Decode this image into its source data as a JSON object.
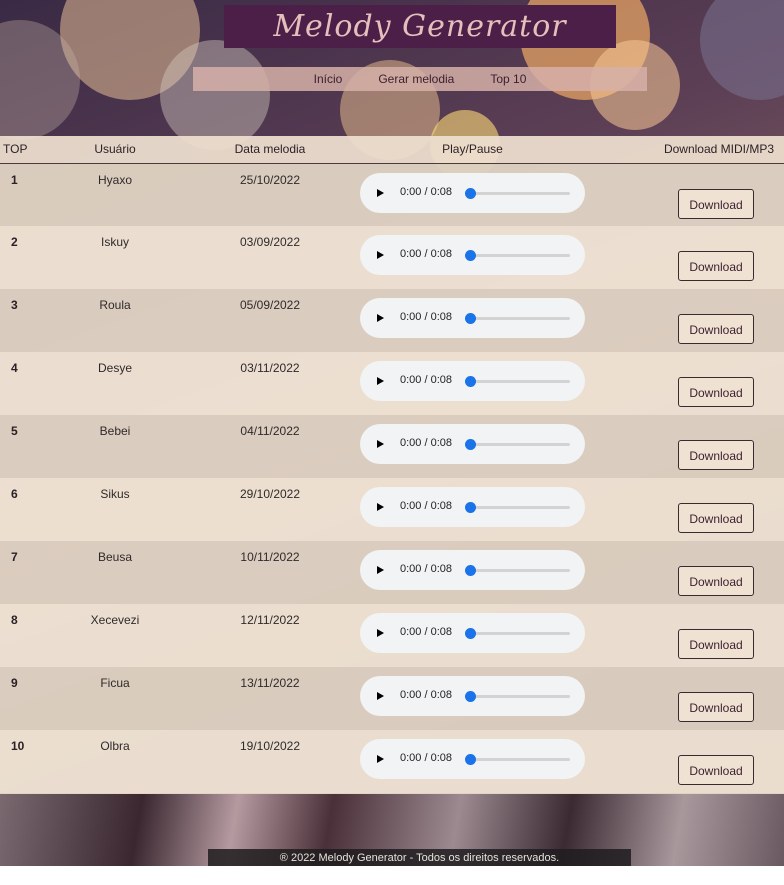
{
  "header": {
    "title": "Melody Generator"
  },
  "nav": {
    "items": [
      "Início",
      "Gerar melodia",
      "Top 10"
    ]
  },
  "table": {
    "headers": {
      "rank": "TOP",
      "user": "Usuário",
      "date": "Data melodia",
      "play": "Play/Pause",
      "download": "Download MIDI/MP3"
    },
    "rows": [
      {
        "rank": "1",
        "user": "Hyaxo",
        "date": "25/10/2022",
        "time": "0:00 / 0:08",
        "download": "Download"
      },
      {
        "rank": "2",
        "user": "Iskuy",
        "date": "03/09/2022",
        "time": "0:00 / 0:08",
        "download": "Download"
      },
      {
        "rank": "3",
        "user": "Roula",
        "date": "05/09/2022",
        "time": "0:00 / 0:08",
        "download": "Download"
      },
      {
        "rank": "4",
        "user": "Desye",
        "date": "03/11/2022",
        "time": "0:00 / 0:08",
        "download": "Download"
      },
      {
        "rank": "5",
        "user": "Bebei",
        "date": "04/11/2022",
        "time": "0:00 / 0:08",
        "download": "Download"
      },
      {
        "rank": "6",
        "user": "Sikus",
        "date": "29/10/2022",
        "time": "0:00 / 0:08",
        "download": "Download"
      },
      {
        "rank": "7",
        "user": "Beusa",
        "date": "10/11/2022",
        "time": "0:00 / 0:08",
        "download": "Download"
      },
      {
        "rank": "8",
        "user": "Xecevezi",
        "date": "12/11/2022",
        "time": "0:00 / 0:08",
        "download": "Download"
      },
      {
        "rank": "9",
        "user": "Ficua",
        "date": "13/11/2022",
        "time": "0:00 / 0:08",
        "download": "Download"
      },
      {
        "rank": "10",
        "user": "Olbra",
        "date": "19/10/2022",
        "time": "0:00 / 0:08",
        "download": "Download"
      }
    ]
  },
  "player": {
    "progress": 0,
    "play_icon": "play-icon"
  },
  "footer": {
    "text": "® 2022 Melody Generator - Todos os direitos reservados."
  },
  "colors": {
    "title_bg": "#4b1f47",
    "title_text": "#e3c0bc",
    "nav_bg": "#d6b0a8",
    "slider_thumb": "#1a73e8"
  }
}
